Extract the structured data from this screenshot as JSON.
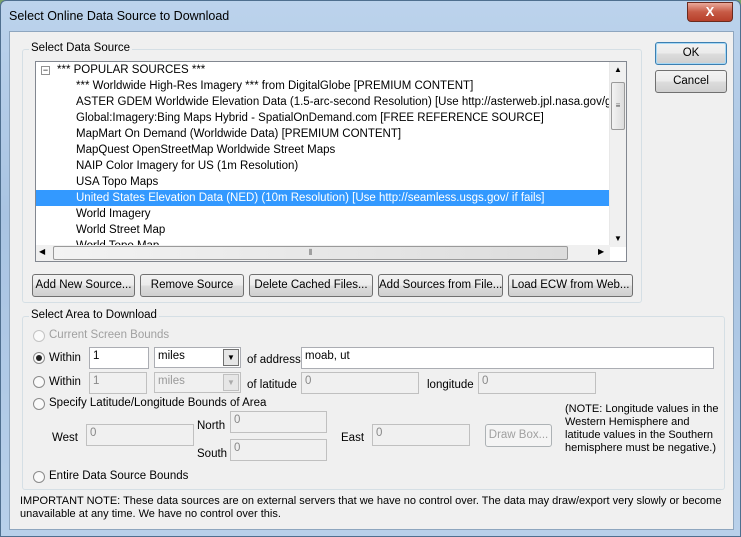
{
  "window": {
    "title": "Select Online Data Source to Download",
    "close_label": "X"
  },
  "buttons": {
    "ok": "OK",
    "cancel": "Cancel",
    "add_new_source": "Add New Source...",
    "remove_source": "Remove Source",
    "delete_cached": "Delete Cached Files...",
    "add_from_file": "Add Sources from File...",
    "load_ecw": "Load ECW from Web...",
    "draw_box": "Draw Box..."
  },
  "source_group": {
    "label": "Select Data Source",
    "tree_root": "*** POPULAR SOURCES ***",
    "expander": "−",
    "items": [
      {
        "label": "*** Worldwide High-Res Imagery *** from DigitalGlobe [PREMIUM CONTENT]",
        "selected": false
      },
      {
        "label": "ASTER GDEM Worldwide Elevation Data (1.5-arc-second Resolution) [Use http://asterweb.jpl.nasa.gov/gdem.a",
        "selected": false
      },
      {
        "label": "Global:Imagery:Bing Maps Hybrid - SpatialOnDemand.com [FREE REFERENCE SOURCE]",
        "selected": false
      },
      {
        "label": "MapMart On Demand (Worldwide Data) [PREMIUM CONTENT]",
        "selected": false
      },
      {
        "label": "MapQuest OpenStreetMap Worldwide Street Maps",
        "selected": false
      },
      {
        "label": "NAIP Color Imagery for US (1m Resolution)",
        "selected": false
      },
      {
        "label": "USA Topo Maps",
        "selected": false
      },
      {
        "label": "United States Elevation Data (NED) (10m Resolution) [Use http://seamless.usgs.gov/ if fails]",
        "selected": true
      },
      {
        "label": "World Imagery",
        "selected": false
      },
      {
        "label": "World Street Map",
        "selected": false
      },
      {
        "label": "World Topo Map",
        "selected": false
      }
    ]
  },
  "area_group": {
    "label": "Select Area to Download",
    "current_screen": "Current Screen Bounds",
    "within_address": {
      "label": "Within",
      "distance": "1",
      "units": "miles",
      "of_label": "of address",
      "address": "moab, ut",
      "checked": true
    },
    "within_latlon": {
      "label": "Within",
      "distance": "1",
      "units": "miles",
      "of_label": "of latitude",
      "latitude": "0",
      "lon_label": "longitude",
      "longitude": "0"
    },
    "specify_bounds": "Specify Latitude/Longitude Bounds of Area",
    "west_label": "West",
    "west": "0",
    "north_label": "North",
    "north": "0",
    "south_label": "South",
    "south": "0",
    "east_label": "East",
    "east": "0",
    "note": "(NOTE: Longitude values in the Western Hemisphere and latitude values in the Southern hemisphere must be negative.)",
    "entire": "Entire Data Source Bounds"
  },
  "important_note": "IMPORTANT NOTE: These data sources are on external servers that we have no control over. The data may draw/export very slowly or become unavailable at any time. We have no control over this."
}
